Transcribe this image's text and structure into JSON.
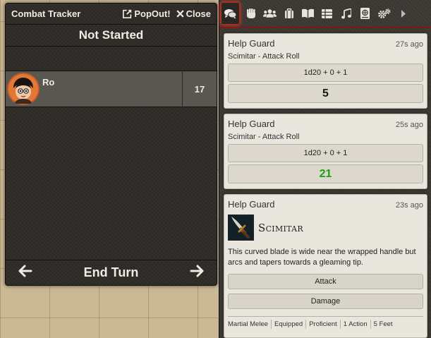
{
  "tracker": {
    "title": "Combat Tracker",
    "popout_label": "PopOut!",
    "close_label": "Close",
    "round_status": "Not Started",
    "combatants": [
      {
        "name": "Ro",
        "initiative": "17"
      }
    ],
    "end_turn_label": "End Turn",
    "icons": {
      "popout": "external-link-icon",
      "close": "close-x-icon",
      "prev": "arrow-left-icon",
      "next": "arrow-right-icon"
    }
  },
  "sidebar": {
    "tabs": [
      {
        "name": "chat-tab",
        "icon": "chat-bubbles-icon",
        "active": true
      },
      {
        "name": "combat-tab",
        "icon": "fist-icon"
      },
      {
        "name": "actors-tab",
        "icon": "users-icon"
      },
      {
        "name": "items-tab",
        "icon": "suitcase-icon"
      },
      {
        "name": "journal-tab",
        "icon": "book-open-icon"
      },
      {
        "name": "tables-tab",
        "icon": "table-icon"
      },
      {
        "name": "playlists-tab",
        "icon": "music-icon"
      },
      {
        "name": "compendium-tab",
        "icon": "atlas-icon"
      },
      {
        "name": "settings-tab",
        "icon": "cogs-icon"
      },
      {
        "name": "collapse-tab",
        "icon": "caret-right-icon"
      }
    ],
    "accent_color": "#c0281e"
  },
  "chat": {
    "messages": [
      {
        "speaker": "Help Guard",
        "time": "27s ago",
        "flavor": "Scimitar - Attack Roll",
        "formula": "1d20 + 0 + 1",
        "total": "5"
      },
      {
        "speaker": "Help Guard",
        "time": "25s ago",
        "flavor": "Scimitar - Attack Roll",
        "formula": "1d20 + 0 + 1",
        "total": "21",
        "total_color": "#18a118"
      },
      {
        "speaker": "Help Guard",
        "time": "23s ago",
        "item_name": "Scimitar",
        "description": "This curved blade is wide near the wrapped handle but arcs and tapers towards a gleaming tip.",
        "buttons": [
          "Attack",
          "Damage"
        ],
        "properties": [
          "Martial Melee",
          "Equipped",
          "Proficient",
          "1 Action",
          "5 Feet"
        ]
      }
    ]
  }
}
